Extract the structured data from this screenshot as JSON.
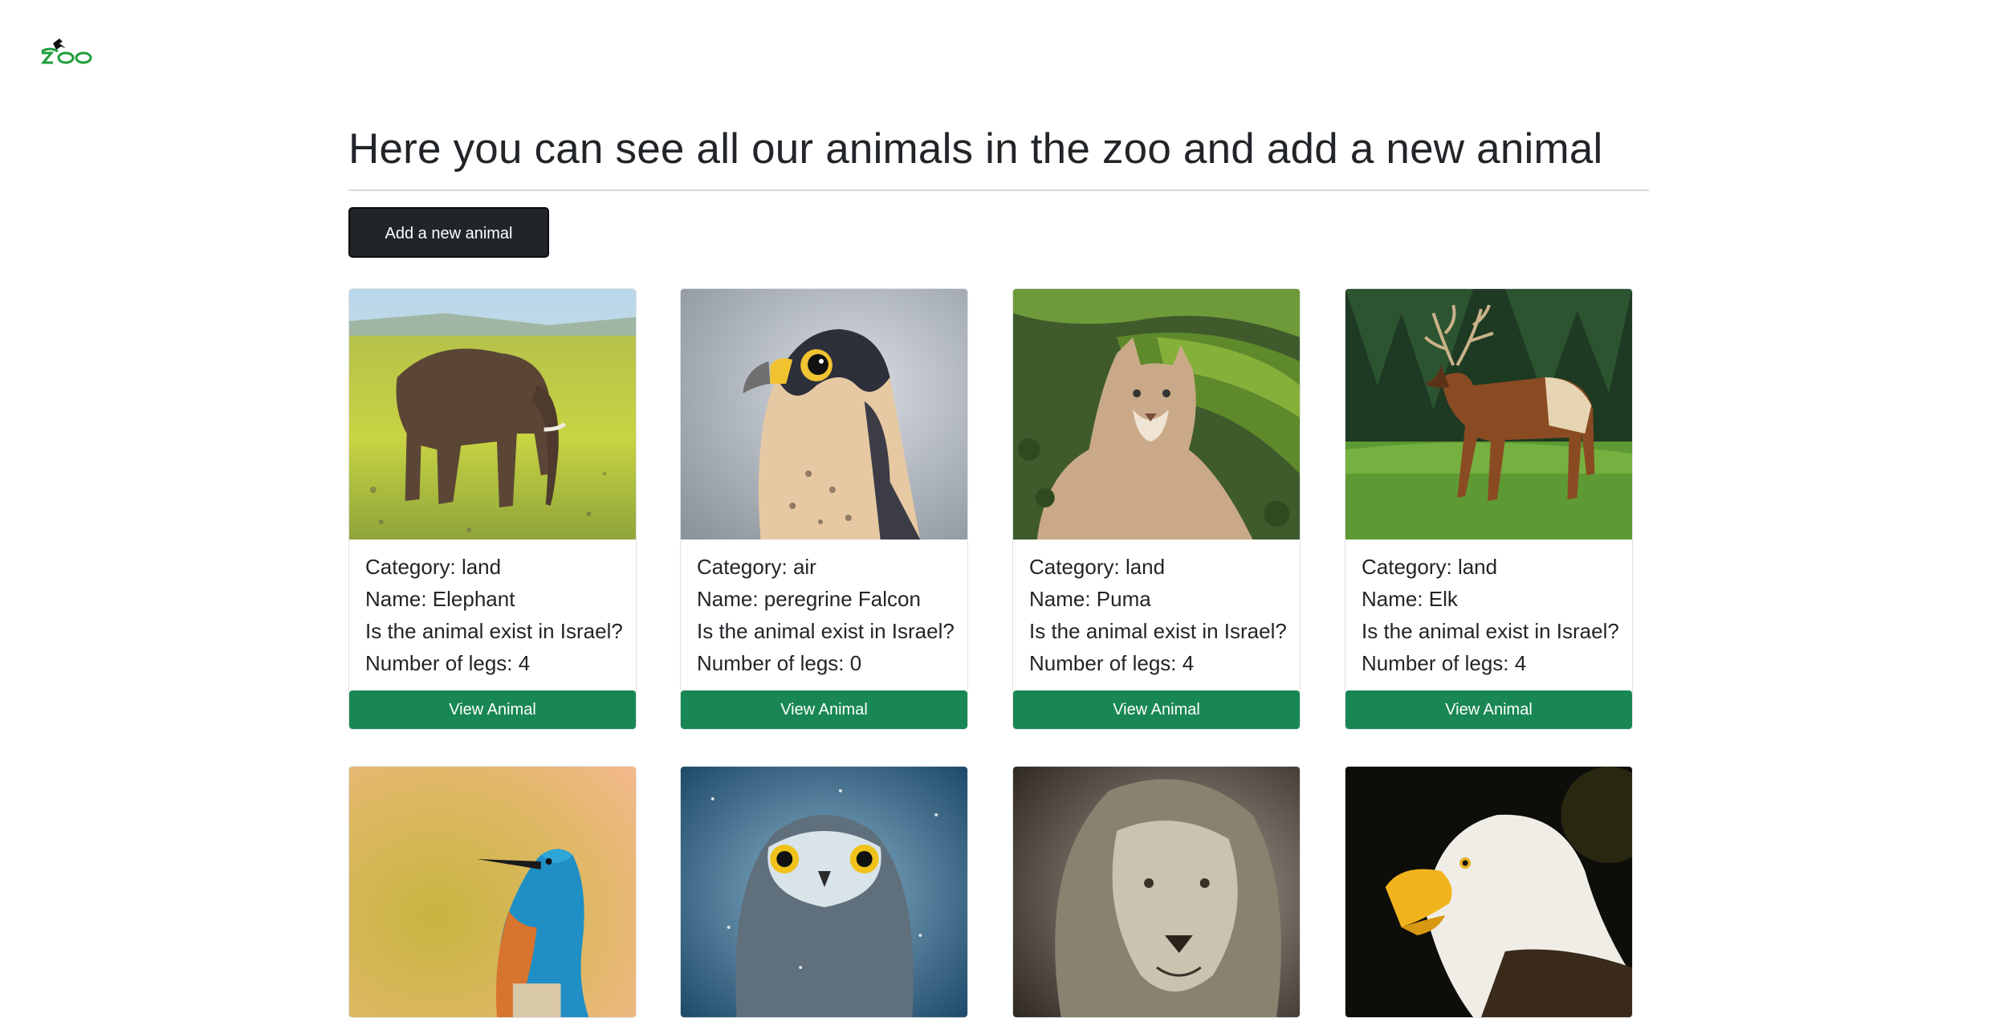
{
  "logo": {
    "text": "zoo",
    "icon": "zoo-logo-icon",
    "color": "#1f9d3a"
  },
  "page_title": "Here you can see all our animals in the zoo and add a new animal",
  "add_button_label": "Add a new animal",
  "cards": [
    {
      "image": "elephant-photo",
      "category_line": "Category: land",
      "name_line": "Name: Elephant",
      "israel_line": "Is the animal exist in Israel?",
      "legs_line": "Number of legs: 4",
      "button_label": "View Animal"
    },
    {
      "image": "peregrine-falcon-photo",
      "category_line": "Category: air",
      "name_line": "Name: peregrine Falcon",
      "israel_line": "Is the animal exist in Israel?",
      "legs_line": "Number of legs: 0",
      "button_label": "View Animal"
    },
    {
      "image": "puma-photo",
      "category_line": "Category: land",
      "name_line": "Name: Puma",
      "israel_line": "Is the animal exist in Israel?",
      "legs_line": "Number of legs: 4",
      "button_label": "View Animal"
    },
    {
      "image": "elk-photo",
      "category_line": "Category: land",
      "name_line": "Name: Elk",
      "israel_line": "Is the animal exist in Israel?",
      "legs_line": "Number of legs: 4",
      "button_label": "View Animal"
    },
    {
      "image": "kingfisher-photo"
    },
    {
      "image": "owl-photo"
    },
    {
      "image": "lion-photo"
    },
    {
      "image": "bald-eagle-photo"
    }
  ],
  "colors": {
    "accent_green": "#198754",
    "dark_button": "#212529",
    "text": "#212529"
  }
}
